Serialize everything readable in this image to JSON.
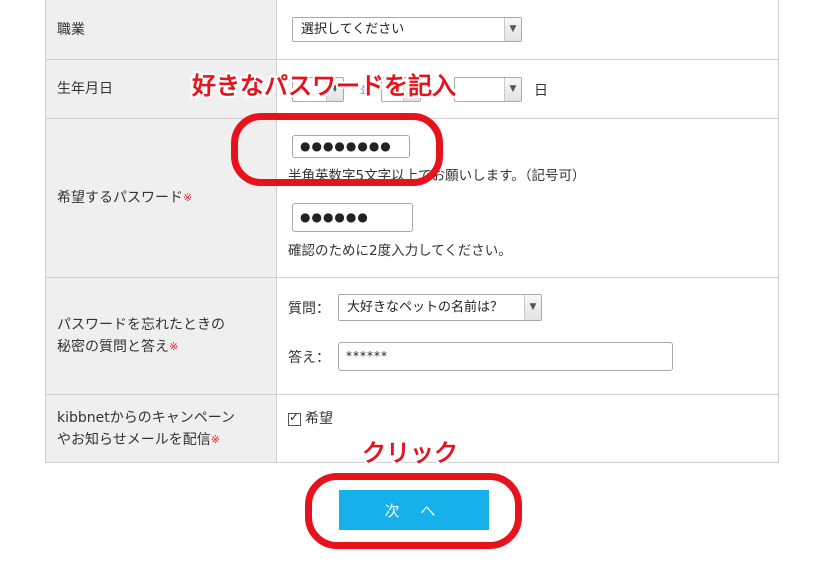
{
  "form": {
    "occupation": {
      "label": "職業",
      "select_value": "選択してください"
    },
    "birthdate": {
      "label": "生年月日",
      "year_suffix": "年",
      "day_suffix": "日"
    },
    "password": {
      "label": "希望するパスワード",
      "required_mark": "※",
      "value1": "●●●●●●●●",
      "hint1": "半角英数字5文字以上でお願いします。（記号可）",
      "value2": "●●●●●●",
      "hint2": "確認のために2度入力してください。"
    },
    "secret": {
      "label_line1": "パスワードを忘れたときの",
      "label_line2": "秘密の質問と答え",
      "required_mark": "※",
      "question_label": "質問：",
      "question_value": "大好きなペットの名前は？",
      "answer_label": "答え：",
      "answer_value": "******"
    },
    "newsletter": {
      "label_line1": "kibbnetからのキャンペーン",
      "label_line2": "やお知らせメールを配信",
      "required_mark": "※",
      "checkbox_label": "希望",
      "checked": true
    }
  },
  "annotations": {
    "password_note": "好きなパスワードを記入",
    "click_note": "クリック",
    "color": "#e8121c"
  },
  "next_button": {
    "label": "次 へ",
    "color": "#16b1eb"
  }
}
